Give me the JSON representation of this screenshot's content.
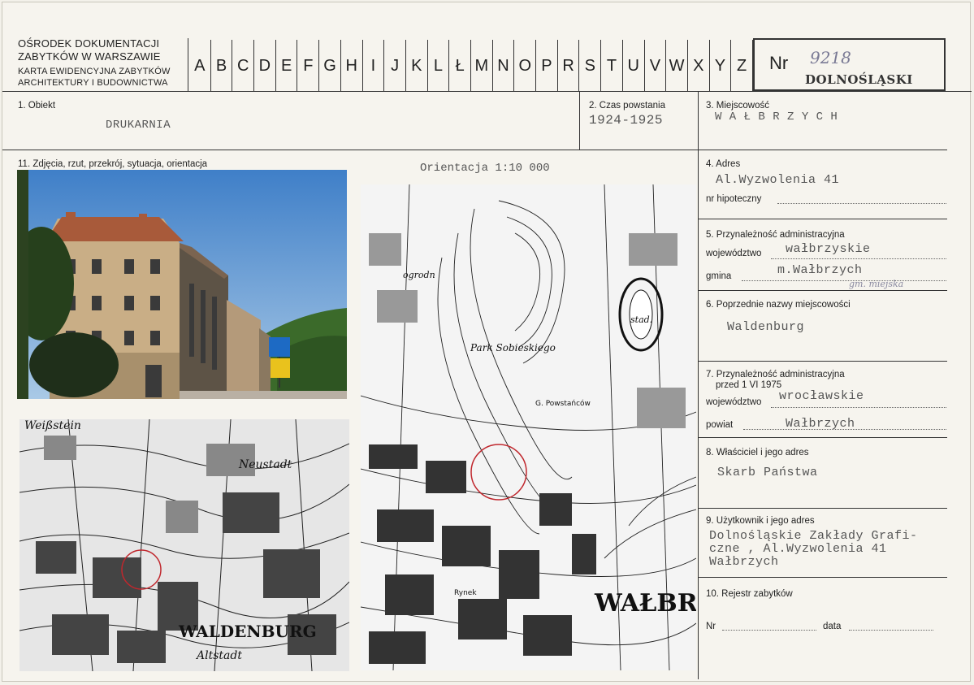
{
  "header": {
    "institution_line1": "OŚRODEK DOKUMENTACJI",
    "institution_line2": "ZABYTKÓW W WARSZAWIE",
    "subtitle_line1": "KARTA EWIDENCYJNA ZABYTKÓW",
    "subtitle_line2": "ARCHITEKTURY I BUDOWNICTWA",
    "letters": [
      "A",
      "B",
      "C",
      "D",
      "E",
      "F",
      "G",
      "H",
      "I",
      "J",
      "K",
      "L",
      "Ł",
      "M",
      "N",
      "O",
      "P",
      "R",
      "S",
      "T",
      "U",
      "V",
      "W",
      "X",
      "Y",
      "Z"
    ],
    "nr_label": "Nr",
    "nr_value": "9218",
    "region": "DOLNOŚLĄSKI"
  },
  "fields": {
    "obiekt_label": "1. Obiekt",
    "obiekt_value": "DRUKARNIA",
    "czas_label": "2. Czas powstania",
    "czas_value": "1924-1925",
    "miejscowosc_label": "3. Miejscowość",
    "miejscowosc_value": "W A Ł B R Z Y C H",
    "zdjecia_label": "11. Zdjęcia, rzut, przekrój, sytuacja, orientacja",
    "orientacja": "Orientacja 1:10 000",
    "adres_label": "4. Adres",
    "adres_value": "Al.Wyzwolenia 41",
    "hipoteczny_label": "nr hipoteczny",
    "przynaleznosc_label": "5. Przynależność administracyjna",
    "wojewodztwo_label": "województwo",
    "wojewodztwo_value": "wałbrzyskie",
    "gmina_label": "gmina",
    "gmina_value": "m.Wałbrzych",
    "gmina_hand": "gm. miejska",
    "poprzednie_label": "6. Poprzednie nazwy miejscowości",
    "poprzednie_value": "Waldenburg",
    "przed_label1": "7. Przynależność administracyjna",
    "przed_label2": "przed 1 VI 1975",
    "woj2_label": "województwo",
    "woj2_value": "wrocławskie",
    "powiat_label": "powiat",
    "powiat_value": "Wałbrzych",
    "wlasciciel_label": "8. Właściciel i jego adres",
    "wlasciciel_value": "Skarb Państwa",
    "uzytkownik_label": "9. Użytkownik i jego adres",
    "uzytkownik_line1": "Dolnośląskie Zakłady Grafi-",
    "uzytkownik_line2": "czne , Al.Wyzwolenia 41",
    "uzytkownik_line3": "Wałbrzych",
    "rejestr_label": "10. Rejestr zabytków",
    "nr_label": "Nr",
    "data_label": "data"
  },
  "map_small": {
    "labels": [
      "Weißstein",
      "Neustadt",
      "WALDENBURG",
      "Altstadt"
    ]
  },
  "map_large": {
    "labels": [
      "Park Sobieskiego",
      "stad.",
      "WAŁBR",
      "G. Powstańców",
      "Rynek",
      "ogrodn"
    ]
  }
}
